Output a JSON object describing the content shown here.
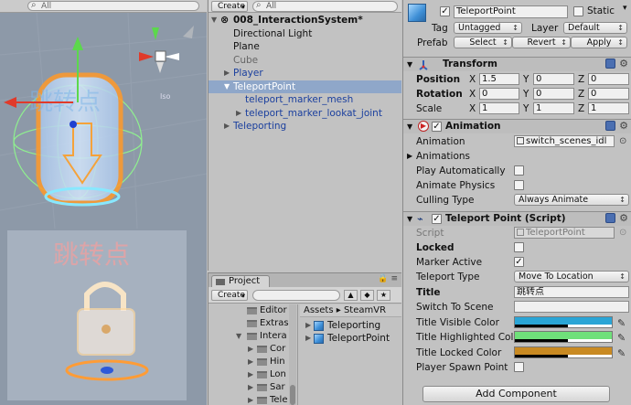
{
  "scene": {
    "toolbar_label": "",
    "search_placeholder": "All",
    "label_top_cn": "跳转点",
    "label_bottom_cn": "跳转点",
    "persp": "Iso"
  },
  "hierarchy": {
    "create_label": "Create",
    "search_placeholder": "All",
    "scene_name": "008_InteractionSystem*",
    "items": [
      {
        "label": "Directional Light"
      },
      {
        "label": "Plane"
      },
      {
        "label": "Cube"
      },
      {
        "label": "Player"
      },
      {
        "label": "TeleportPoint"
      },
      {
        "label": "teleport_marker_mesh"
      },
      {
        "label": "teleport_marker_lookat_joint"
      },
      {
        "label": "Teleporting"
      }
    ]
  },
  "project": {
    "tab_label": "Project",
    "create_label": "Create",
    "folders": [
      "Editor",
      "Extras",
      "Intera",
      "Cor",
      "Hin",
      "Lon",
      "Sar",
      "Tele"
    ],
    "breadcrumb_root": "Assets",
    "breadcrumb_sep": "▸",
    "breadcrumb_leaf": "SteamVR",
    "assets": [
      "Teleporting",
      "TeleportPoint"
    ]
  },
  "inspector": {
    "object_name": "TeleportPoint",
    "static_label": "Static",
    "tag_label": "Tag",
    "tag_value": "Untagged",
    "layer_label": "Layer",
    "layer_value": "Default",
    "prefab_label": "Prefab",
    "prefab_select": "Select",
    "prefab_revert": "Revert",
    "prefab_apply": "Apply",
    "transform": {
      "title": "Transform",
      "position_label": "Position",
      "rotation_label": "Rotation",
      "scale_label": "Scale",
      "axis_x": "X",
      "axis_y": "Y",
      "axis_z": "Z",
      "position": [
        "1.5",
        "0",
        "0"
      ],
      "rotation": [
        "0",
        "0",
        "0"
      ],
      "scale": [
        "1",
        "1",
        "1"
      ]
    },
    "animation": {
      "title": "Animation",
      "animation_label": "Animation",
      "animation_value": "switch_scenes_idl",
      "animations_label": "Animations",
      "play_auto_label": "Play Automatically",
      "animate_physics_label": "Animate Physics",
      "culling_label": "Culling Type",
      "culling_value": "Always Animate"
    },
    "teleport_point": {
      "title": "Teleport Point (Script)",
      "script_label": "Script",
      "script_value": "TeleportPoint",
      "locked_label": "Locked",
      "marker_active_label": "Marker Active",
      "teleport_type_label": "Teleport Type",
      "teleport_type_value": "Move To Location",
      "title_label": "Title",
      "title_value": "跳转点",
      "switch_scene_label": "Switch To Scene",
      "switch_scene_value": "",
      "title_visible_label": "Title Visible Color",
      "title_highlighted_label": "Title Highlighted Colo",
      "title_locked_label": "Title Locked Color",
      "player_spawn_label": "Player Spawn Point",
      "colors": {
        "visible": "#2aa5d6",
        "highlighted": "#6fe07a",
        "locked": "#c98a22"
      }
    },
    "add_component": "Add Component"
  }
}
